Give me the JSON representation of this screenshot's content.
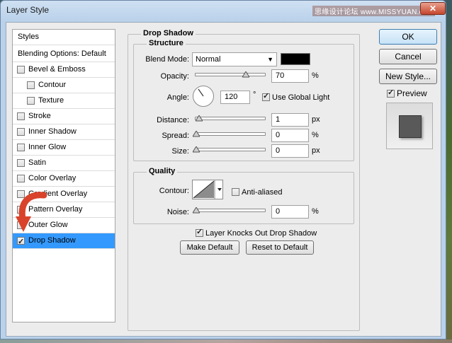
{
  "window": {
    "title": "Layer Style",
    "watermark": "思缘设计论坛 www.MISSYUAN.com",
    "close_label": "✕"
  },
  "style_list": {
    "styles_label": "Styles",
    "blending_label": "Blending Options: Default",
    "items": [
      {
        "label": "Bevel & Emboss",
        "checked": false
      },
      {
        "label": "Contour",
        "checked": false
      },
      {
        "label": "Texture",
        "checked": false
      },
      {
        "label": "Stroke",
        "checked": false
      },
      {
        "label": "Inner Shadow",
        "checked": false
      },
      {
        "label": "Inner Glow",
        "checked": false
      },
      {
        "label": "Satin",
        "checked": false
      },
      {
        "label": "Color Overlay",
        "checked": false
      },
      {
        "label": "Gradient Overlay",
        "checked": false
      },
      {
        "label": "Pattern Overlay",
        "checked": false
      },
      {
        "label": "Outer Glow",
        "checked": false
      },
      {
        "label": "Drop Shadow",
        "checked": true
      }
    ]
  },
  "drop_shadow": {
    "section_title": "Drop Shadow",
    "structure_title": "Structure",
    "blend_mode_label": "Blend Mode:",
    "blend_mode_value": "Normal",
    "shadow_color": "#000000",
    "opacity_label": "Opacity:",
    "opacity_value": "70",
    "opacity_level": 0.7,
    "opacity_unit": "%",
    "angle_label": "Angle:",
    "angle_value": "120",
    "angle_unit": "°",
    "use_global_light_label": "Use Global Light",
    "use_global_light_checked": true,
    "distance_label": "Distance:",
    "distance_value": "1",
    "distance_unit": "px",
    "spread_label": "Spread:",
    "spread_value": "0",
    "spread_unit": "%",
    "size_label": "Size:",
    "size_value": "0",
    "size_unit": "px"
  },
  "quality": {
    "title": "Quality",
    "contour_label": "Contour:",
    "anti_aliased_label": "Anti-aliased",
    "anti_aliased_checked": false,
    "noise_label": "Noise:",
    "noise_value": "0",
    "noise_unit": "%"
  },
  "layer_knocks_out_label": "Layer Knocks Out Drop Shadow",
  "layer_knocks_out_checked": true,
  "make_default_label": "Make Default",
  "reset_default_label": "Reset to Default",
  "right_panel": {
    "ok_label": "OK",
    "cancel_label": "Cancel",
    "new_style_label": "New Style...",
    "preview_label": "Preview",
    "preview_checked": true
  },
  "colors": {
    "selection": "#3399ff",
    "arrow": "#d9432b"
  }
}
